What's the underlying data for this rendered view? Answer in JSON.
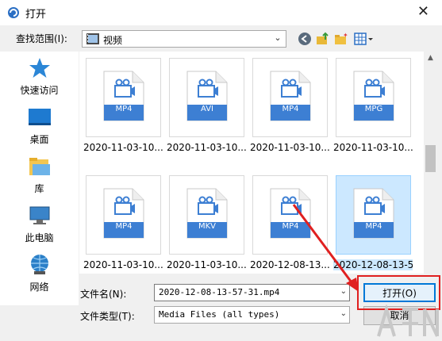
{
  "window": {
    "title": "打开",
    "close_glyph": "✕"
  },
  "toolbar": {
    "lookin_label": "查找范围(I):",
    "lookin_value": "视频",
    "icons": [
      "back-icon",
      "up-folder-icon",
      "new-folder-icon",
      "view-menu-icon"
    ]
  },
  "places": [
    {
      "label": "快速访问",
      "icon": "star-icon"
    },
    {
      "label": "桌面",
      "icon": "desktop-icon"
    },
    {
      "label": "库",
      "icon": "library-icon"
    },
    {
      "label": "此电脑",
      "icon": "computer-icon"
    },
    {
      "label": "网络",
      "icon": "network-icon"
    }
  ],
  "files": [
    {
      "name": "2020-11-03-10...",
      "ext": "MP4"
    },
    {
      "name": "2020-11-03-10...",
      "ext": "AVI"
    },
    {
      "name": "2020-11-03-10...",
      "ext": "MP4"
    },
    {
      "name": "2020-11-03-10...",
      "ext": "MPG"
    },
    {
      "name": "2020-11-03-10...",
      "ext": "MP4"
    },
    {
      "name": "2020-11-03-10...",
      "ext": "MKV"
    },
    {
      "name": "2020-12-08-13...",
      "ext": "MP4"
    },
    {
      "name": "2020-12-08-13-5",
      "ext": "MP4",
      "selected": true
    }
  ],
  "bottom": {
    "filename_label": "文件名(N):",
    "filename_value": "2020-12-08-13-57-31.mp4",
    "filetype_label": "文件类型(T):",
    "filetype_value": "Media Files (all types)",
    "open_label": "打开(O)",
    "cancel_label": "取消"
  },
  "colors": {
    "accent": "#0078d7",
    "file_badge": "#3d7fd3",
    "annotation": "#e02020",
    "selection": "#cce8ff"
  }
}
